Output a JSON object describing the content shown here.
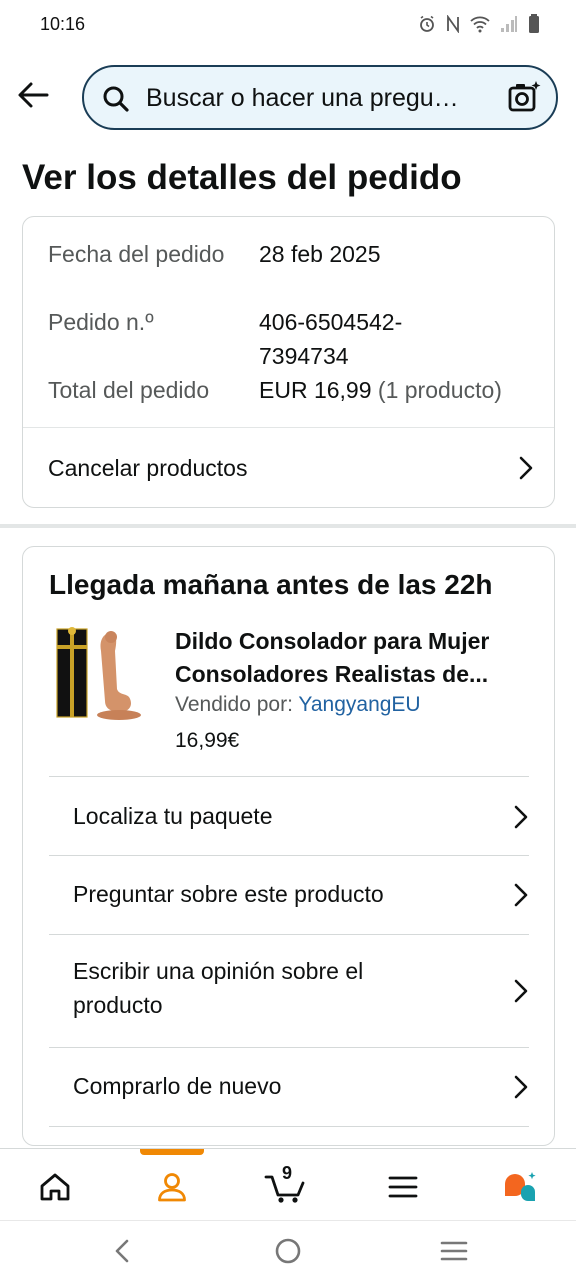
{
  "status_bar": {
    "time": "10:16"
  },
  "search": {
    "placeholder": "Buscar o hacer una pregu…"
  },
  "page": {
    "title": "Ver los detalles del pedido"
  },
  "order": {
    "date_label": "Fecha del pedido",
    "date_value": "28 feb 2025",
    "number_label": "Pedido n.º",
    "number_value_line1": "406-6504542-",
    "number_value_line2": "7394734",
    "total_label": "Total del pedido",
    "total_value": "EUR 16,99",
    "total_count": "(1 producto)",
    "cancel_label": "Cancelar productos"
  },
  "delivery": {
    "title": "Llegada mañana antes de las 22h",
    "product_name_line1": "Dildo Consolador para Mujer",
    "product_name_line2": "Consoladores Realistas de...",
    "seller_label": "Vendido por:",
    "seller_name": "YangyangEU",
    "price": "16,99€",
    "actions": [
      {
        "label": "Localiza tu paquete"
      },
      {
        "label": "Preguntar sobre este producto"
      },
      {
        "label_line1": "Escribir una opinión sobre el",
        "label_line2": "producto"
      },
      {
        "label": "Comprarlo de nuevo"
      }
    ]
  },
  "bottom_nav": {
    "cart_count": "9",
    "active": "account",
    "accent_color": "#f08804"
  },
  "icons": {
    "back": "arrow-left-icon",
    "search": "search-icon",
    "camera": "camera-icon",
    "chevron": "chevron-right-icon",
    "home": "home-icon",
    "account": "account-icon",
    "cart": "cart-icon",
    "menu": "menu-icon",
    "rufus": "rufus-assistant-icon"
  }
}
